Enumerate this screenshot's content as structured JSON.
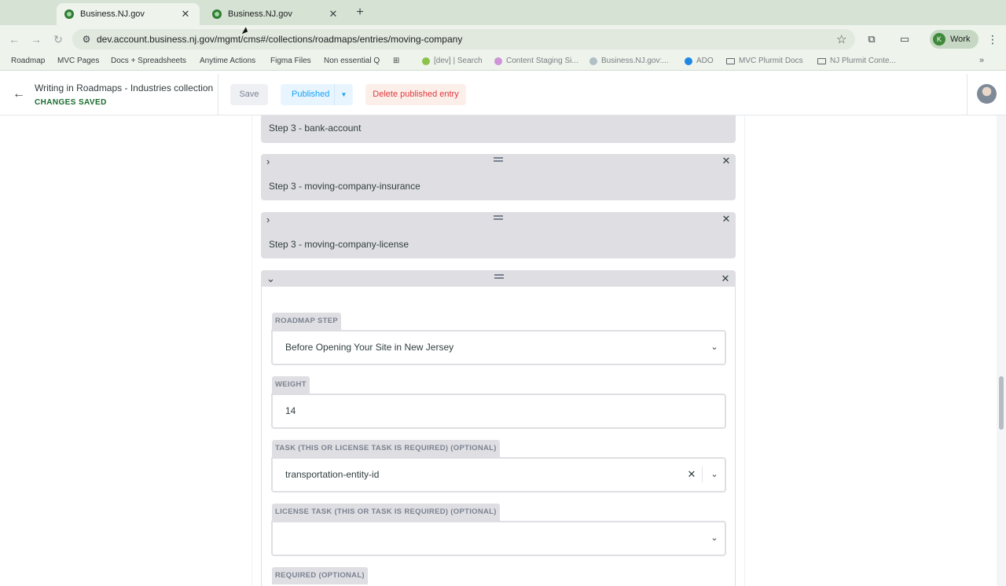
{
  "browser": {
    "tabs": [
      {
        "title": "Business.NJ.gov",
        "active": true
      },
      {
        "title": "Business.NJ.gov",
        "active": false
      }
    ],
    "url": "dev.account.business.nj.gov/mgmt/cms#/collections/roadmaps/entries/moving-company",
    "profile_label": "Work",
    "profile_initial": "K",
    "bookmarks": [
      "Roadmap",
      "MVC Pages",
      "Docs + Spreadsheets",
      "Anytime Actions",
      "Figma Files",
      "Non essential Q",
      "[dev] | Search",
      "Content Staging Si...",
      "Business.NJ.gov:...",
      "ADO",
      "MVC Plurmit Docs",
      "NJ Plurmit Conte..."
    ]
  },
  "header": {
    "entry_title": "Writing in Roadmaps - Industries collection",
    "status": "CHANGES SAVED",
    "save_label": "Save",
    "published_label": "Published",
    "delete_label": "Delete published entry"
  },
  "list_items": [
    {
      "label": "Step 3 - bank-account"
    },
    {
      "label": "Step 3 - moving-company-insurance"
    },
    {
      "label": "Step 3 - moving-company-license"
    }
  ],
  "expanded_item": {
    "fields": [
      {
        "label": "ROADMAP STEP",
        "value": "Before Opening Your Site in New Jersey"
      },
      {
        "label": "WEIGHT",
        "value": "14"
      },
      {
        "label": "TASK (THIS OR LICENSE TASK IS REQUIRED) (OPTIONAL)",
        "value": "transportation-entity-id"
      },
      {
        "label": "LICENSE TASK (THIS OR TASK IS REQUIRED) (OPTIONAL)",
        "value": ""
      },
      {
        "label": "REQUIRED (OPTIONAL)"
      }
    ]
  },
  "colors": {
    "accent": "#17a2f8",
    "saved": "#1a6b2f",
    "danger": "#e0393e",
    "item_bg": "#dfdfe3"
  }
}
